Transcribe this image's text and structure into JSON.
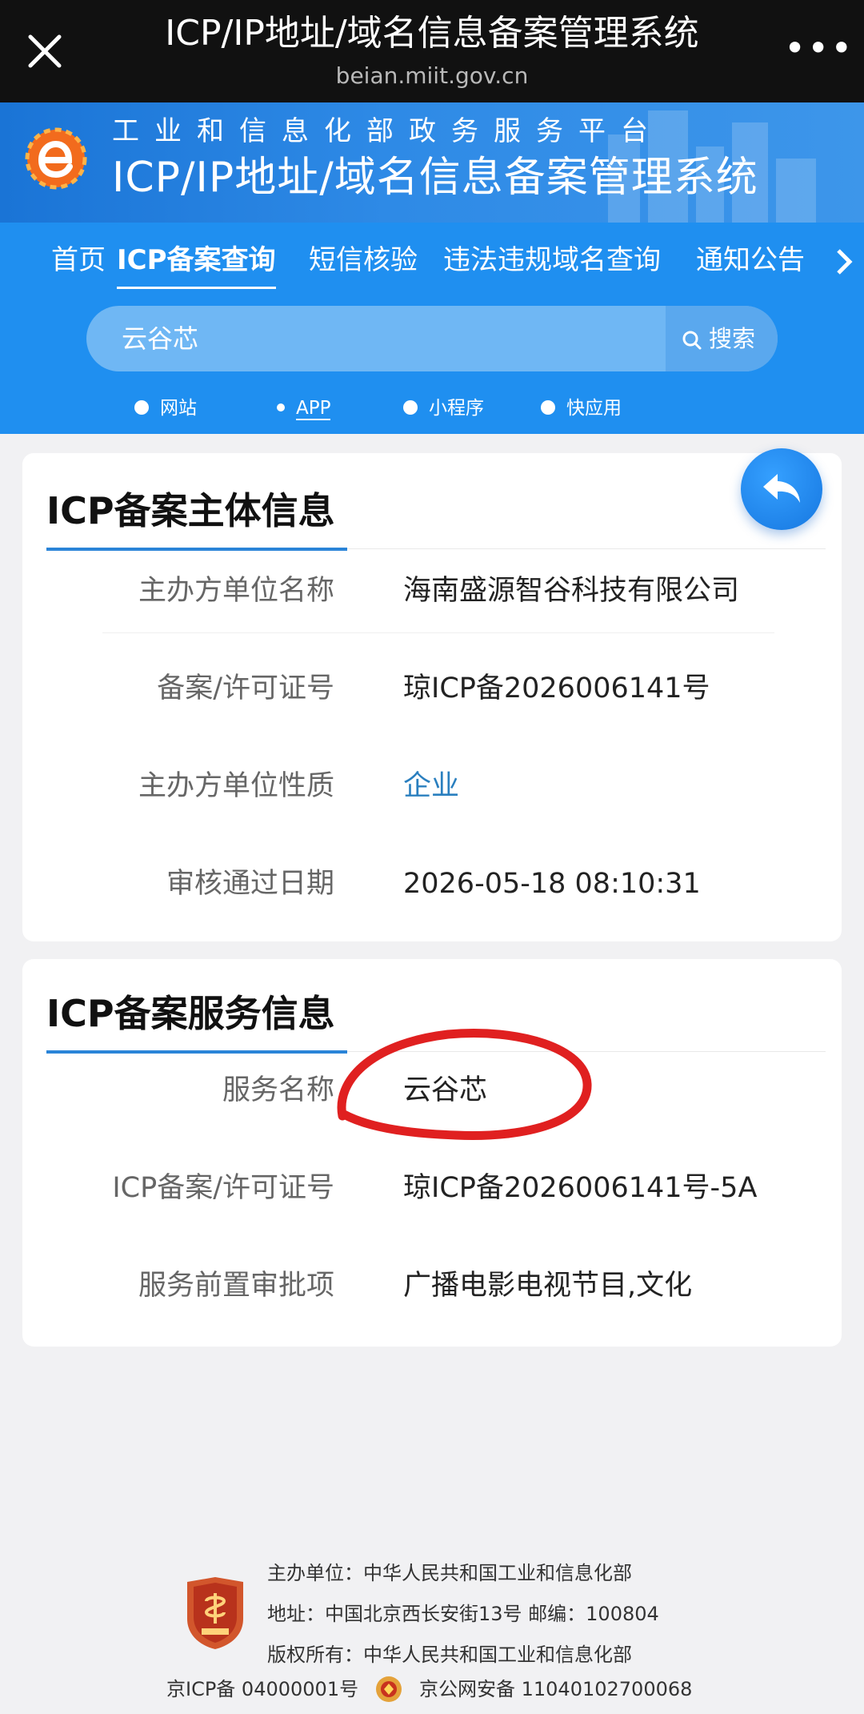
{
  "topbar": {
    "title": "ICP/IP地址/域名信息备案管理系统",
    "url": "beian.miit.gov.cn",
    "more": "•••"
  },
  "banner": {
    "subtitle": "工业和信息化部政务服务平台",
    "title": "ICP/IP地址/域名信息备案管理系统"
  },
  "nav": {
    "tabs": [
      "首页",
      "ICP备案查询",
      "短信核验",
      "违法违规域名查询",
      "通知公告"
    ],
    "active_tab": "ICP备案查询"
  },
  "search": {
    "value": "云谷芯",
    "button": "搜索"
  },
  "types": {
    "options": [
      "网站",
      "APP",
      "小程序",
      "快应用"
    ],
    "selected": "APP"
  },
  "entity": {
    "title": "ICP备案主体信息",
    "rows": [
      {
        "label": "主办方单位名称",
        "value": "海南盛源智谷科技有限公司"
      },
      {
        "label": "备案/许可证号",
        "value": "琼ICP备2026006141号"
      },
      {
        "label": "主办方单位性质",
        "value": "企业"
      },
      {
        "label": "审核通过日期",
        "value": "2026-05-18 08:10:31"
      }
    ]
  },
  "service": {
    "title": "ICP备案服务信息",
    "rows": [
      {
        "label": "服务名称",
        "value": "云谷芯"
      },
      {
        "label": "ICP备案/许可证号",
        "value": "琼ICP备2026006141号-5A"
      },
      {
        "label": "服务前置审批项",
        "value": "广播电影电视节目,文化"
      }
    ]
  },
  "footer": {
    "sponsor": "主办单位：中华人民共和国工业和信息化部",
    "address": "地址：中国北京西长安街13号 邮编：100804",
    "copyright": "版权所有：中华人民共和国工业和信息化部",
    "icp": "京ICP备 04000001号",
    "police": "京公网安备 11040102700068"
  },
  "colors": {
    "topbar_bg": "#111111",
    "header_blue": "#1f8ff0",
    "accent": "#2a84d8",
    "annotation_red": "#e02020"
  },
  "icons": [
    "close-icon",
    "more-icon",
    "site-logo-icon",
    "chevron-right-icon",
    "search-icon",
    "back-arrow-icon",
    "emblem-icon",
    "police-badge-icon"
  ]
}
